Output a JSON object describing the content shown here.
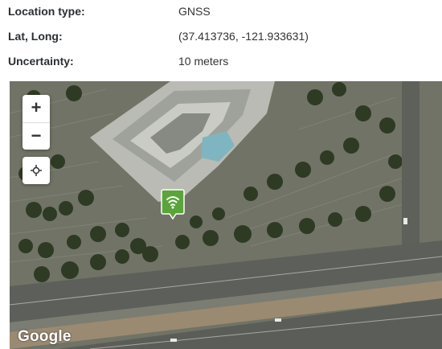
{
  "location": {
    "rows": [
      {
        "label": "Location type:",
        "value": "GNSS"
      },
      {
        "label": "Lat, Long:",
        "value": "(37.413736, -121.933631)"
      },
      {
        "label": "Uncertainty:",
        "value": "10 meters"
      }
    ]
  },
  "map": {
    "zoom_in_label": "+",
    "zoom_out_label": "−",
    "logo_text": "Google",
    "marker_icon": "wifi-icon",
    "marker_color": "#5aa43a"
  }
}
